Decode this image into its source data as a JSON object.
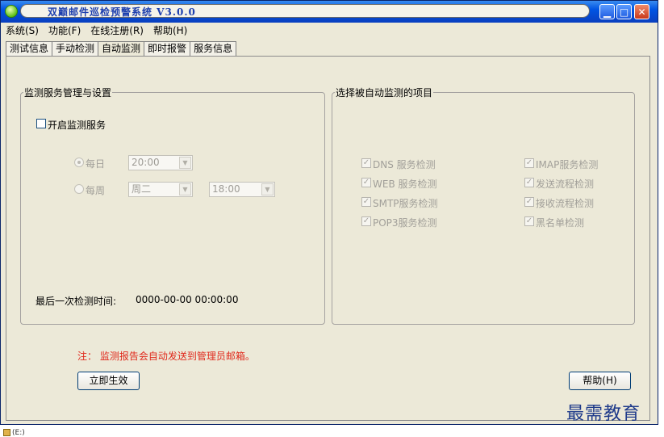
{
  "window": {
    "title": "双巅邮件巡检预警系统 V3.0.0"
  },
  "menu": [
    {
      "label": "系统(S)"
    },
    {
      "label": "功能(F)"
    },
    {
      "label": "在线注册(R)"
    },
    {
      "label": "帮助(H)"
    }
  ],
  "tabs": [
    {
      "label": "测试信息",
      "active": false
    },
    {
      "label": "手动检测",
      "active": false
    },
    {
      "label": "自动监测",
      "active": true
    },
    {
      "label": "即时报警",
      "active": false
    },
    {
      "label": "服务信息",
      "active": false
    }
  ],
  "service_group": {
    "legend": "监测服务管理与设置",
    "enable_label": "开启监测服务",
    "enable_checked": false,
    "daily_label": "每日",
    "daily_time": "20:00",
    "weekly_label": "每周",
    "weekly_day": "周二",
    "weekly_time": "18:00",
    "last_check_label": "最后一次检测时间:",
    "last_check_value": "0000-00-00 00:00:00"
  },
  "items_group": {
    "legend": "选择被自动监测的项目",
    "items_left": [
      "DNS 服务检测",
      "WEB 服务检测",
      "SMTP服务检测",
      "POP3服务检测"
    ],
    "items_right": [
      "IMAP服务检测",
      "发送流程检测",
      "接收流程检测",
      "黑名单检测"
    ]
  },
  "note": "注： 监测报告会自动发送到管理员邮箱。",
  "buttons": {
    "apply": "立即生效",
    "help": "帮助(H)"
  },
  "watermark": "最需教育",
  "taskbar": {
    "item": "(E:)"
  }
}
